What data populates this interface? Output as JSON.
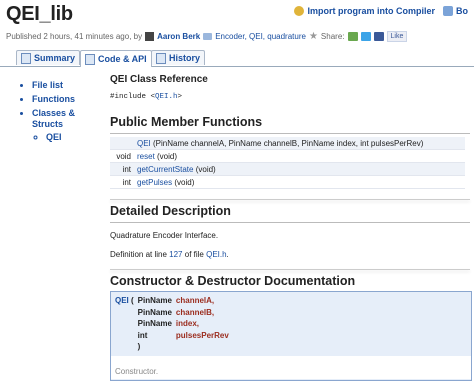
{
  "page": {
    "title": "QEI_lib"
  },
  "actions": {
    "import_label": "Import program into Compiler",
    "bookmark_label": "Bo"
  },
  "meta": {
    "published": "Published 2 hours, 41 minutes ago, by",
    "author": "Aaron Berk",
    "tags": "Encoder, QEI, quadrature",
    "share_label": "Share:",
    "like_label": "Like"
  },
  "tabs": [
    {
      "label": "Summary"
    },
    {
      "label": "Code & API"
    },
    {
      "label": "History"
    }
  ],
  "sidebar": {
    "items": [
      "File list",
      "Functions",
      "Classes & Structs"
    ],
    "sub_items": [
      "QEI"
    ]
  },
  "content": {
    "class_ref_title": "QEI Class Reference",
    "include_prefix": "#include <",
    "include_file": "QEI.h",
    "include_suffix": ">",
    "public_functions_heading": "Public Member Functions",
    "functions": [
      {
        "ret": "",
        "name": "QEI",
        "args": " (PinName channelA, PinName channelB, PinName index, int pulsesPerRev)"
      },
      {
        "ret": "void",
        "name": "reset",
        "args": " (void)"
      },
      {
        "ret": "int",
        "name": "getCurrentState",
        "args": " (void)"
      },
      {
        "ret": "int",
        "name": "getPulses",
        "args": " (void)"
      }
    ],
    "detailed_heading": "Detailed Description",
    "detailed_text": "Quadrature Encoder Interface.",
    "definition_prefix": "Definition at line ",
    "definition_line": "127",
    "definition_mid": " of file ",
    "definition_file": "QEI.h",
    "definition_suffix": ".",
    "ctor_heading": "Constructor & Destructor Documentation",
    "ctor": {
      "name": "QEI",
      "open": " ( ",
      "params": [
        {
          "type": "PinName",
          "name": "channelA,"
        },
        {
          "type": "PinName",
          "name": "channelB,"
        },
        {
          "type": "PinName",
          "name": "index,"
        },
        {
          "type": "int",
          "name": "pulsesPerRev"
        }
      ],
      "close": ")",
      "doc_text": "Constructor."
    }
  },
  "colors": {
    "link": "#1a4fa0",
    "param": "#9b2d1f",
    "proto_bg": "#e6eef9"
  }
}
